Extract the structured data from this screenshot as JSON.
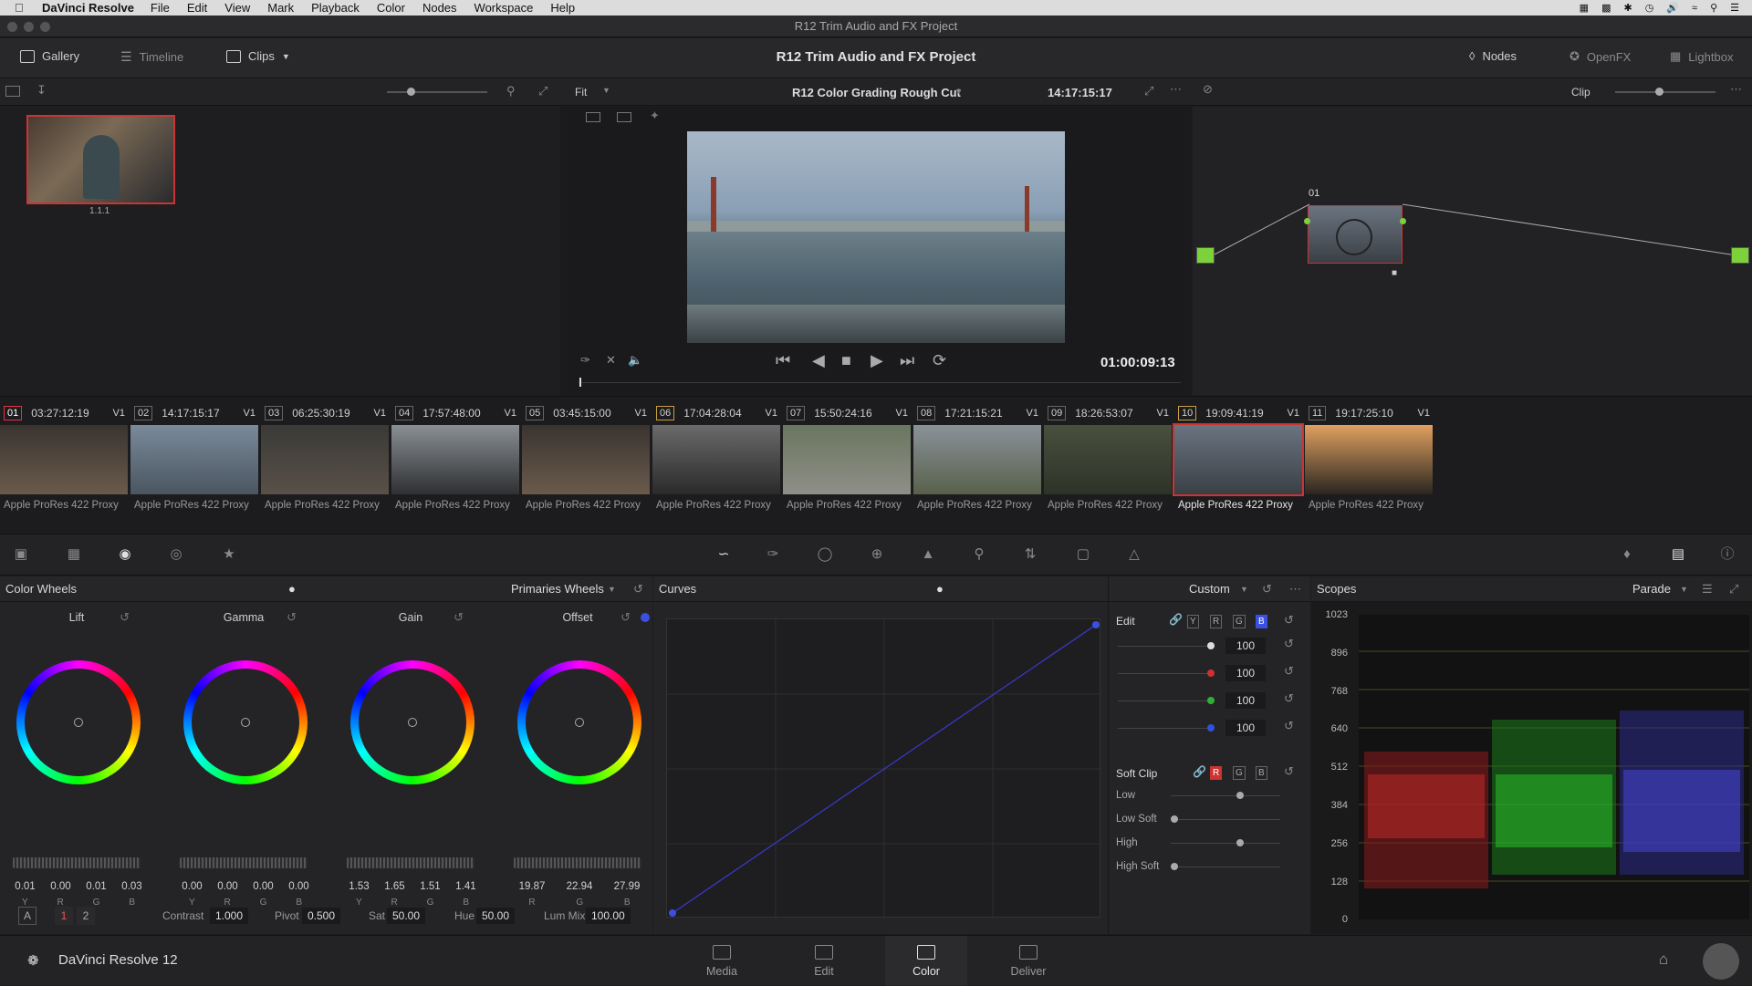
{
  "menubar": {
    "app_name": "DaVinci Resolve",
    "items": [
      "File",
      "Edit",
      "View",
      "Mark",
      "Playback",
      "Color",
      "Nodes",
      "Workspace",
      "Help"
    ]
  },
  "window_title": "R12 Trim Audio and FX Project",
  "toolbar": {
    "gallery_label": "Gallery",
    "timeline_label": "Timeline",
    "clips_label": "Clips",
    "project_title": "R12 Trim Audio and FX Project",
    "nodes_label": "Nodes",
    "openfx_label": "OpenFX",
    "lightbox_label": "Lightbox"
  },
  "viewerbar": {
    "fit_label": "Fit",
    "timeline_name": "R12 Color Grading Rough Cut",
    "source_timecode": "14:17:15:17",
    "clip_mode": "Clip"
  },
  "gallery": {
    "still_label": "1.1.1"
  },
  "viewer": {
    "record_timecode": "01:00:09:13"
  },
  "node_graph": {
    "node_label": "01"
  },
  "clips": [
    {
      "num": "01",
      "tc": "03:27:12:19",
      "track": "V1",
      "codec": "Apple ProRes 422 Proxy",
      "colors": [
        "#3a3430",
        "#6a5a4c"
      ]
    },
    {
      "num": "02",
      "tc": "14:17:15:17",
      "track": "V1",
      "codec": "Apple ProRes 422 Proxy",
      "colors": [
        "#7a8a9a",
        "#4a5560"
      ]
    },
    {
      "num": "03",
      "tc": "06:25:30:19",
      "track": "V1",
      "codec": "Apple ProRes 422 Proxy",
      "colors": [
        "#3a3a36",
        "#5a5048"
      ]
    },
    {
      "num": "04",
      "tc": "17:57:48:00",
      "track": "V1",
      "codec": "Apple ProRes 422 Proxy",
      "colors": [
        "#8a8f94",
        "#2e3032"
      ]
    },
    {
      "num": "05",
      "tc": "03:45:15:00",
      "track": "V1",
      "codec": "Apple ProRes 422 Proxy",
      "colors": [
        "#3a3430",
        "#6a5a4c"
      ]
    },
    {
      "num": "06",
      "tc": "17:04:28:04",
      "track": "V1",
      "codec": "Apple ProRes 422 Proxy",
      "colors": [
        "#6a6a6a",
        "#2a2a2a"
      ]
    },
    {
      "num": "07",
      "tc": "15:50:24:16",
      "track": "V1",
      "codec": "Apple ProRes 422 Proxy",
      "colors": [
        "#6a7660",
        "#8f8f88"
      ]
    },
    {
      "num": "08",
      "tc": "17:21:15:21",
      "track": "V1",
      "codec": "Apple ProRes 422 Proxy",
      "colors": [
        "#8a929a",
        "#58604a"
      ]
    },
    {
      "num": "09",
      "tc": "18:26:53:07",
      "track": "V1",
      "codec": "Apple ProRes 422 Proxy",
      "colors": [
        "#49503e",
        "#2e3328"
      ]
    },
    {
      "num": "10",
      "tc": "19:09:41:19",
      "track": "V1",
      "codec": "Apple ProRes 422 Proxy",
      "colors": [
        "#6a7480",
        "#3a3f45"
      ]
    },
    {
      "num": "11",
      "tc": "19:17:25:10",
      "track": "V1",
      "codec": "Apple ProRes 422 Proxy",
      "colors": [
        "#e0a060",
        "#2a2620"
      ]
    }
  ],
  "color_wheels": {
    "title": "Color Wheels",
    "mode": "Primaries Wheels",
    "wheels": [
      {
        "name": "Lift",
        "values": [
          "0.01",
          "0.00",
          "0.01",
          "0.03"
        ],
        "labels": [
          "Y",
          "R",
          "G",
          "B"
        ]
      },
      {
        "name": "Gamma",
        "values": [
          "0.00",
          "0.00",
          "0.00",
          "0.00"
        ],
        "labels": [
          "Y",
          "R",
          "G",
          "B"
        ]
      },
      {
        "name": "Gain",
        "values": [
          "1.53",
          "1.65",
          "1.51",
          "1.41"
        ],
        "labels": [
          "Y",
          "R",
          "G",
          "B"
        ]
      },
      {
        "name": "Offset",
        "values": [
          "19.87",
          "22.94",
          "27.99"
        ],
        "labels": [
          "R",
          "G",
          "B"
        ]
      }
    ],
    "footer": {
      "mode_a": "A",
      "page1": "1",
      "page2": "2",
      "contrast_label": "Contrast",
      "contrast": "1.000",
      "pivot_label": "Pivot",
      "pivot": "0.500",
      "sat_label": "Sat",
      "sat": "50.00",
      "hue_label": "Hue",
      "hue": "50.00",
      "lummix_label": "Lum Mix",
      "lummix": "100.00"
    }
  },
  "curves": {
    "title": "Curves",
    "mode": "Custom",
    "edit_label": "Edit",
    "channels": [
      "Y",
      "R",
      "G",
      "B"
    ],
    "intensity": [
      {
        "value": "100",
        "color": "#dddddd"
      },
      {
        "value": "100",
        "color": "#d03030"
      },
      {
        "value": "100",
        "color": "#30b030"
      },
      {
        "value": "100",
        "color": "#3050e0"
      }
    ],
    "softclip_label": "Soft Clip",
    "softclip_rows": [
      "Low",
      "Low Soft",
      "High",
      "High Soft"
    ]
  },
  "scopes": {
    "title": "Scopes",
    "mode": "Parade",
    "scale": [
      "1023",
      "896",
      "768",
      "640",
      "512",
      "384",
      "256",
      "128",
      "0"
    ]
  },
  "pagebar": {
    "app_label": "DaVinci Resolve 12",
    "pages": [
      "Media",
      "Edit",
      "Color",
      "Deliver"
    ],
    "active_page": "Color"
  }
}
